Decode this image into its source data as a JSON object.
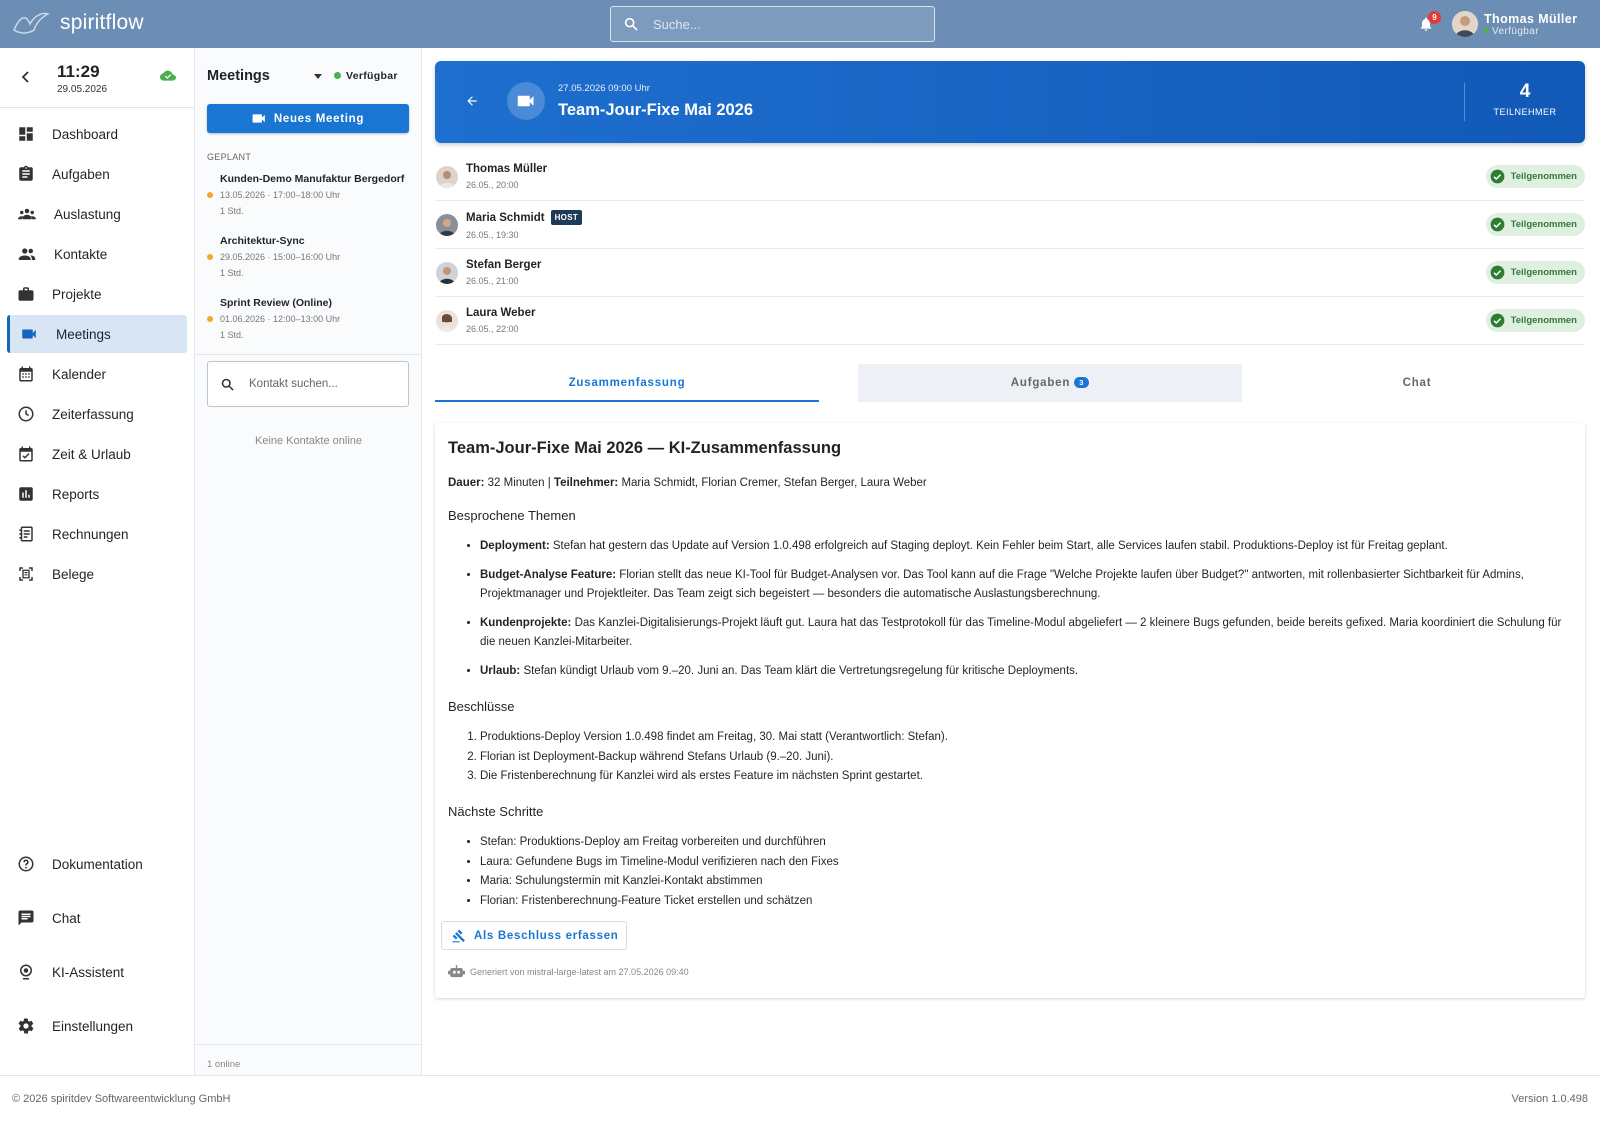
{
  "app": {
    "brand": "spiritflow"
  },
  "topbar": {
    "search_placeholder": "Suche...",
    "notification_count": "9",
    "user_name": "Thomas Müller",
    "user_status": "Verfügbar"
  },
  "clock": {
    "time": "11:29",
    "date": "29.05.2026"
  },
  "nav": {
    "items": [
      {
        "label": "Dashboard",
        "icon": "dashboard-icon"
      },
      {
        "label": "Aufgaben",
        "icon": "clipboard-icon"
      },
      {
        "label": "Auslastung",
        "icon": "team-icon"
      },
      {
        "label": "Kontakte",
        "icon": "people-icon"
      },
      {
        "label": "Projekte",
        "icon": "briefcase-icon"
      },
      {
        "label": "Meetings",
        "icon": "video-camera-icon"
      },
      {
        "label": "Kalender",
        "icon": "calendar-icon"
      },
      {
        "label": "Zeiterfassung",
        "icon": "clock-icon"
      },
      {
        "label": "Zeit & Urlaub",
        "icon": "calendar-check-icon"
      },
      {
        "label": "Reports",
        "icon": "bar-chart-icon"
      },
      {
        "label": "Rechnungen",
        "icon": "invoice-icon"
      },
      {
        "label": "Belege",
        "icon": "receipt-scan-icon"
      }
    ],
    "bottom": [
      {
        "label": "Dokumentation",
        "icon": "help-icon"
      },
      {
        "label": "Chat",
        "icon": "chat-icon"
      },
      {
        "label": "KI-Assistent",
        "icon": "ai-assistant-icon"
      },
      {
        "label": "Einstellungen",
        "icon": "gear-icon"
      }
    ]
  },
  "meetings_panel": {
    "title": "Meetings",
    "status": "Verfügbar",
    "new_button": "Neues Meeting",
    "section": "GEPLANT",
    "items": [
      {
        "title": "Kunden-Demo Manufaktur Bergedorf",
        "date": "13.05.2026 · 17:00–18:00 Uhr",
        "duration": "1 Std."
      },
      {
        "title": "Architektur-Sync",
        "date": "29.05.2026 · 15:00–16:00 Uhr",
        "duration": "1 Std."
      },
      {
        "title": "Sprint Review (Online)",
        "date": "01.06.2026 · 12:00–13:00 Uhr",
        "duration": "1 Std."
      }
    ],
    "contact_search_placeholder": "Kontakt suchen...",
    "no_contacts": "Keine Kontakte online",
    "online_count": "1 online"
  },
  "meeting": {
    "datetime": "27.05.2026 09:00 Uhr",
    "title": "Team-Jour-Fixe Mai 2026",
    "participant_count": "4",
    "participant_label": "TEILNEHMER"
  },
  "participants": [
    {
      "name": "Thomas Müller",
      "time": "26.05., 20:00",
      "status": "Teilgenommen",
      "host": ""
    },
    {
      "name": "Maria Schmidt",
      "time": "26.05., 19:30",
      "status": "Teilgenommen",
      "host": "HOST"
    },
    {
      "name": "Stefan Berger",
      "time": "26.05., 21:00",
      "status": "Teilgenommen",
      "host": ""
    },
    {
      "name": "Laura Weber",
      "time": "26.05., 22:00",
      "status": "Teilgenommen",
      "host": ""
    }
  ],
  "tabs": [
    {
      "label": "Zusammenfassung"
    },
    {
      "label": "Aufgaben",
      "count": "3"
    },
    {
      "label": "Chat"
    }
  ],
  "summary": {
    "title": "Team-Jour-Fixe Mai 2026 — KI-Zusammenfassung",
    "meta": {
      "dauer_label": "Dauer:",
      "dauer_value": " 32 Minuten | ",
      "teilnehmer_label": "Teilnehmer:",
      "teilnehmer_value": " Maria Schmidt, Florian Cremer, Stefan Berger, Laura Weber"
    },
    "h_themen": "Besprochene Themen",
    "themen": [
      {
        "label": "Deployment:",
        "text": " Stefan hat gestern das Update auf Version 1.0.498 erfolgreich auf Staging deployt. Kein Fehler beim Start, alle Services laufen stabil. Produktions-Deploy ist für Freitag geplant."
      },
      {
        "label": "Budget-Analyse Feature:",
        "text": " Florian stellt das neue KI-Tool für Budget-Analysen vor. Das Tool kann auf die Frage \"Welche Projekte laufen über Budget?\" antworten, mit rollenbasierter Sichtbarkeit für Admins, Projektmanager und Projektleiter. Das Team zeigt sich begeistert — besonders die automatische Auslastungsberechnung."
      },
      {
        "label": "Kundenprojekte:",
        "text": " Das Kanzlei-Digitalisierungs-Projekt läuft gut. Laura hat das Testprotokoll für das Timeline-Modul abgeliefert — 2 kleinere Bugs gefunden, beide bereits gefixed. Maria koordiniert die Schulung für die neuen Kanzlei-Mitarbeiter."
      },
      {
        "label": "Urlaub:",
        "text": " Stefan kündigt Urlaub vom 9.–20. Juni an. Das Team klärt die Vertretungsregelung für kritische Deployments."
      }
    ],
    "h_beschluesse": "Beschlüsse",
    "beschluesse": [
      "Produktions-Deploy Version 1.0.498 findet am Freitag, 30. Mai statt (Verantwortlich: Stefan).",
      "Florian ist Deployment-Backup während Stefans Urlaub (9.–20. Juni).",
      "Die Fristenberechnung für Kanzlei wird als erstes Feature im nächsten Sprint gestartet."
    ],
    "h_schritte": "Nächste Schritte",
    "schritte": [
      "Stefan: Produktions-Deploy am Freitag vorbereiten und durchführen",
      "Laura: Gefundene Bugs im Timeline-Modul verifizieren nach den Fixes",
      "Maria: Schulungstermin mit Kanzlei-Kontakt abstimmen",
      "Florian: Fristenberechnung-Feature Ticket erstellen und schätzen"
    ],
    "action_button": "Als Beschluss erfassen",
    "generated": "Generiert von mistral-large-latest am 27.05.2026 09:40"
  },
  "footer": {
    "copyright": "© 2026 spiritdev Softwareentwicklung GmbH",
    "version": "Version 1.0.498"
  },
  "colors": {
    "topbar": "#6c8eb4",
    "primary": "#1976d2",
    "banner": "#1565c0",
    "success": "#2e7d32",
    "status_green": "#4caf50"
  }
}
